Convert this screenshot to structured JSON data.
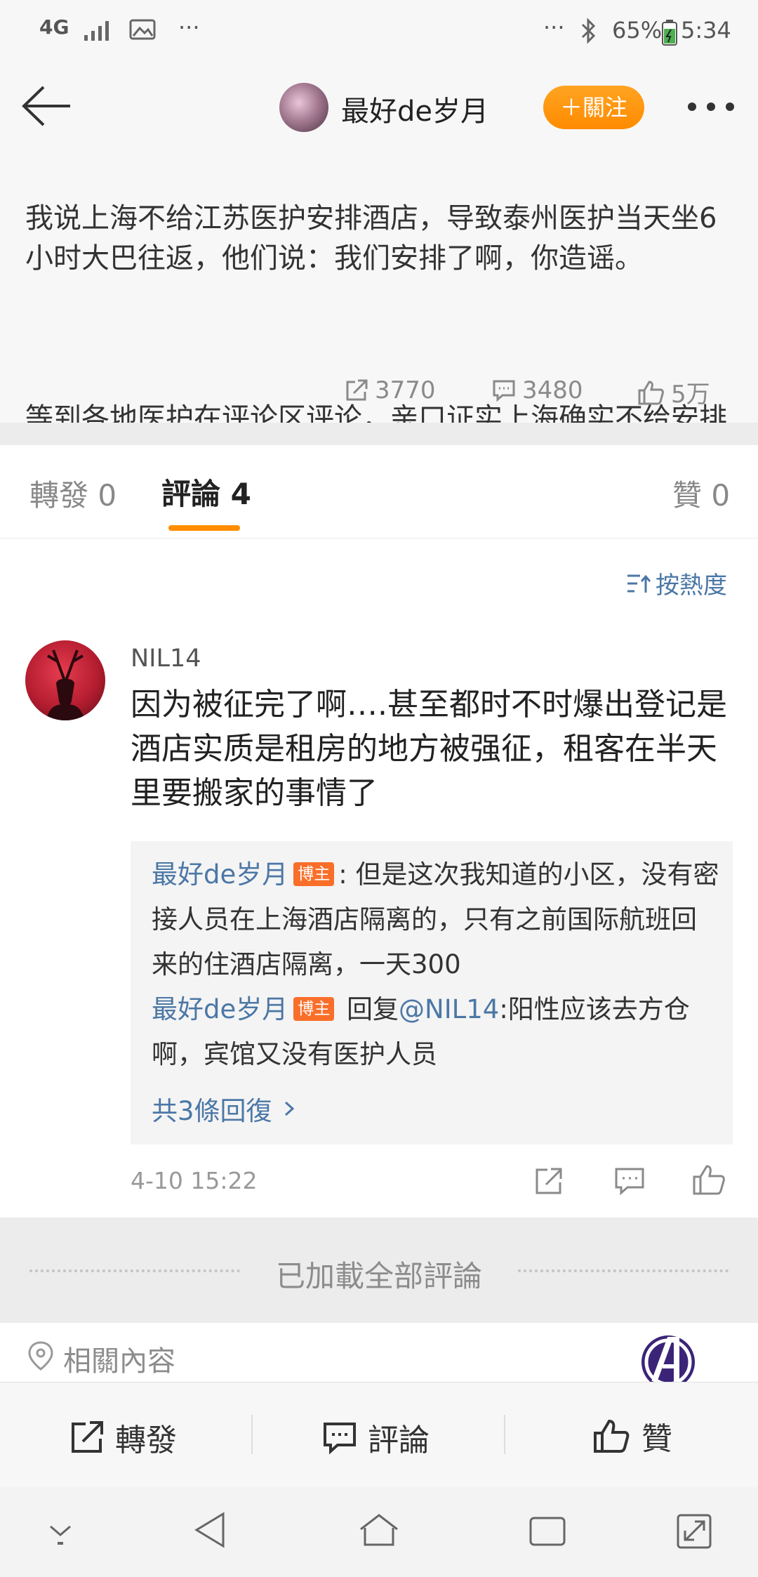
{
  "status_bar": {
    "network": "4G",
    "dots_left": "···",
    "dots_right": "···",
    "battery": "65%",
    "time": "5:34"
  },
  "header": {
    "username": "最好de岁月",
    "follow_label": "＋關注"
  },
  "post": {
    "paragraph1": "我说上海不给江苏医护安排酒店，导致泰州医护当天坐6小时大巴往返，他们说：我们安排了啊，你造谣。",
    "paragraph2": "等到各地医护在评论区评论，亲口证实上海确实不给安排酒店。然后他们说：哎呀酒店不",
    "reposts": "3770",
    "comments": "3480",
    "likes": "5万"
  },
  "tabs": {
    "repost": "轉發 0",
    "comment": "評論 4",
    "like": "贊 0"
  },
  "sort_label": "按熱度",
  "comment": {
    "username": "NIL14",
    "text": "因为被征完了啊….甚至都时不时爆出登记是酒店实质是租房的地方被强征，租客在半天里要搬家的事情了",
    "replies": [
      {
        "name": "最好de岁月",
        "badge": "博主",
        "text": ": 但是这次我知道的小区，没有密接人员在上海酒店隔离的，只有之前国际航班回来的住酒店隔离，一天300"
      },
      {
        "name": "最好de岁月",
        "badge": "博主",
        "prefix": " 回复",
        "mention": "@NIL14",
        "text": ":阳性应该去方仓啊，宾馆又没有医护人员"
      }
    ],
    "more_replies": "共3條回復",
    "time": "4-10 15:22"
  },
  "load_all": "已加載全部評論",
  "related": "相關內容",
  "action_bar": {
    "repost": "轉發",
    "comment": "評論",
    "like": "贊"
  },
  "colors": {
    "accent_orange": "#ff8d00",
    "link_blue": "#4b77a6",
    "badge_orange": "#f96f2a"
  }
}
